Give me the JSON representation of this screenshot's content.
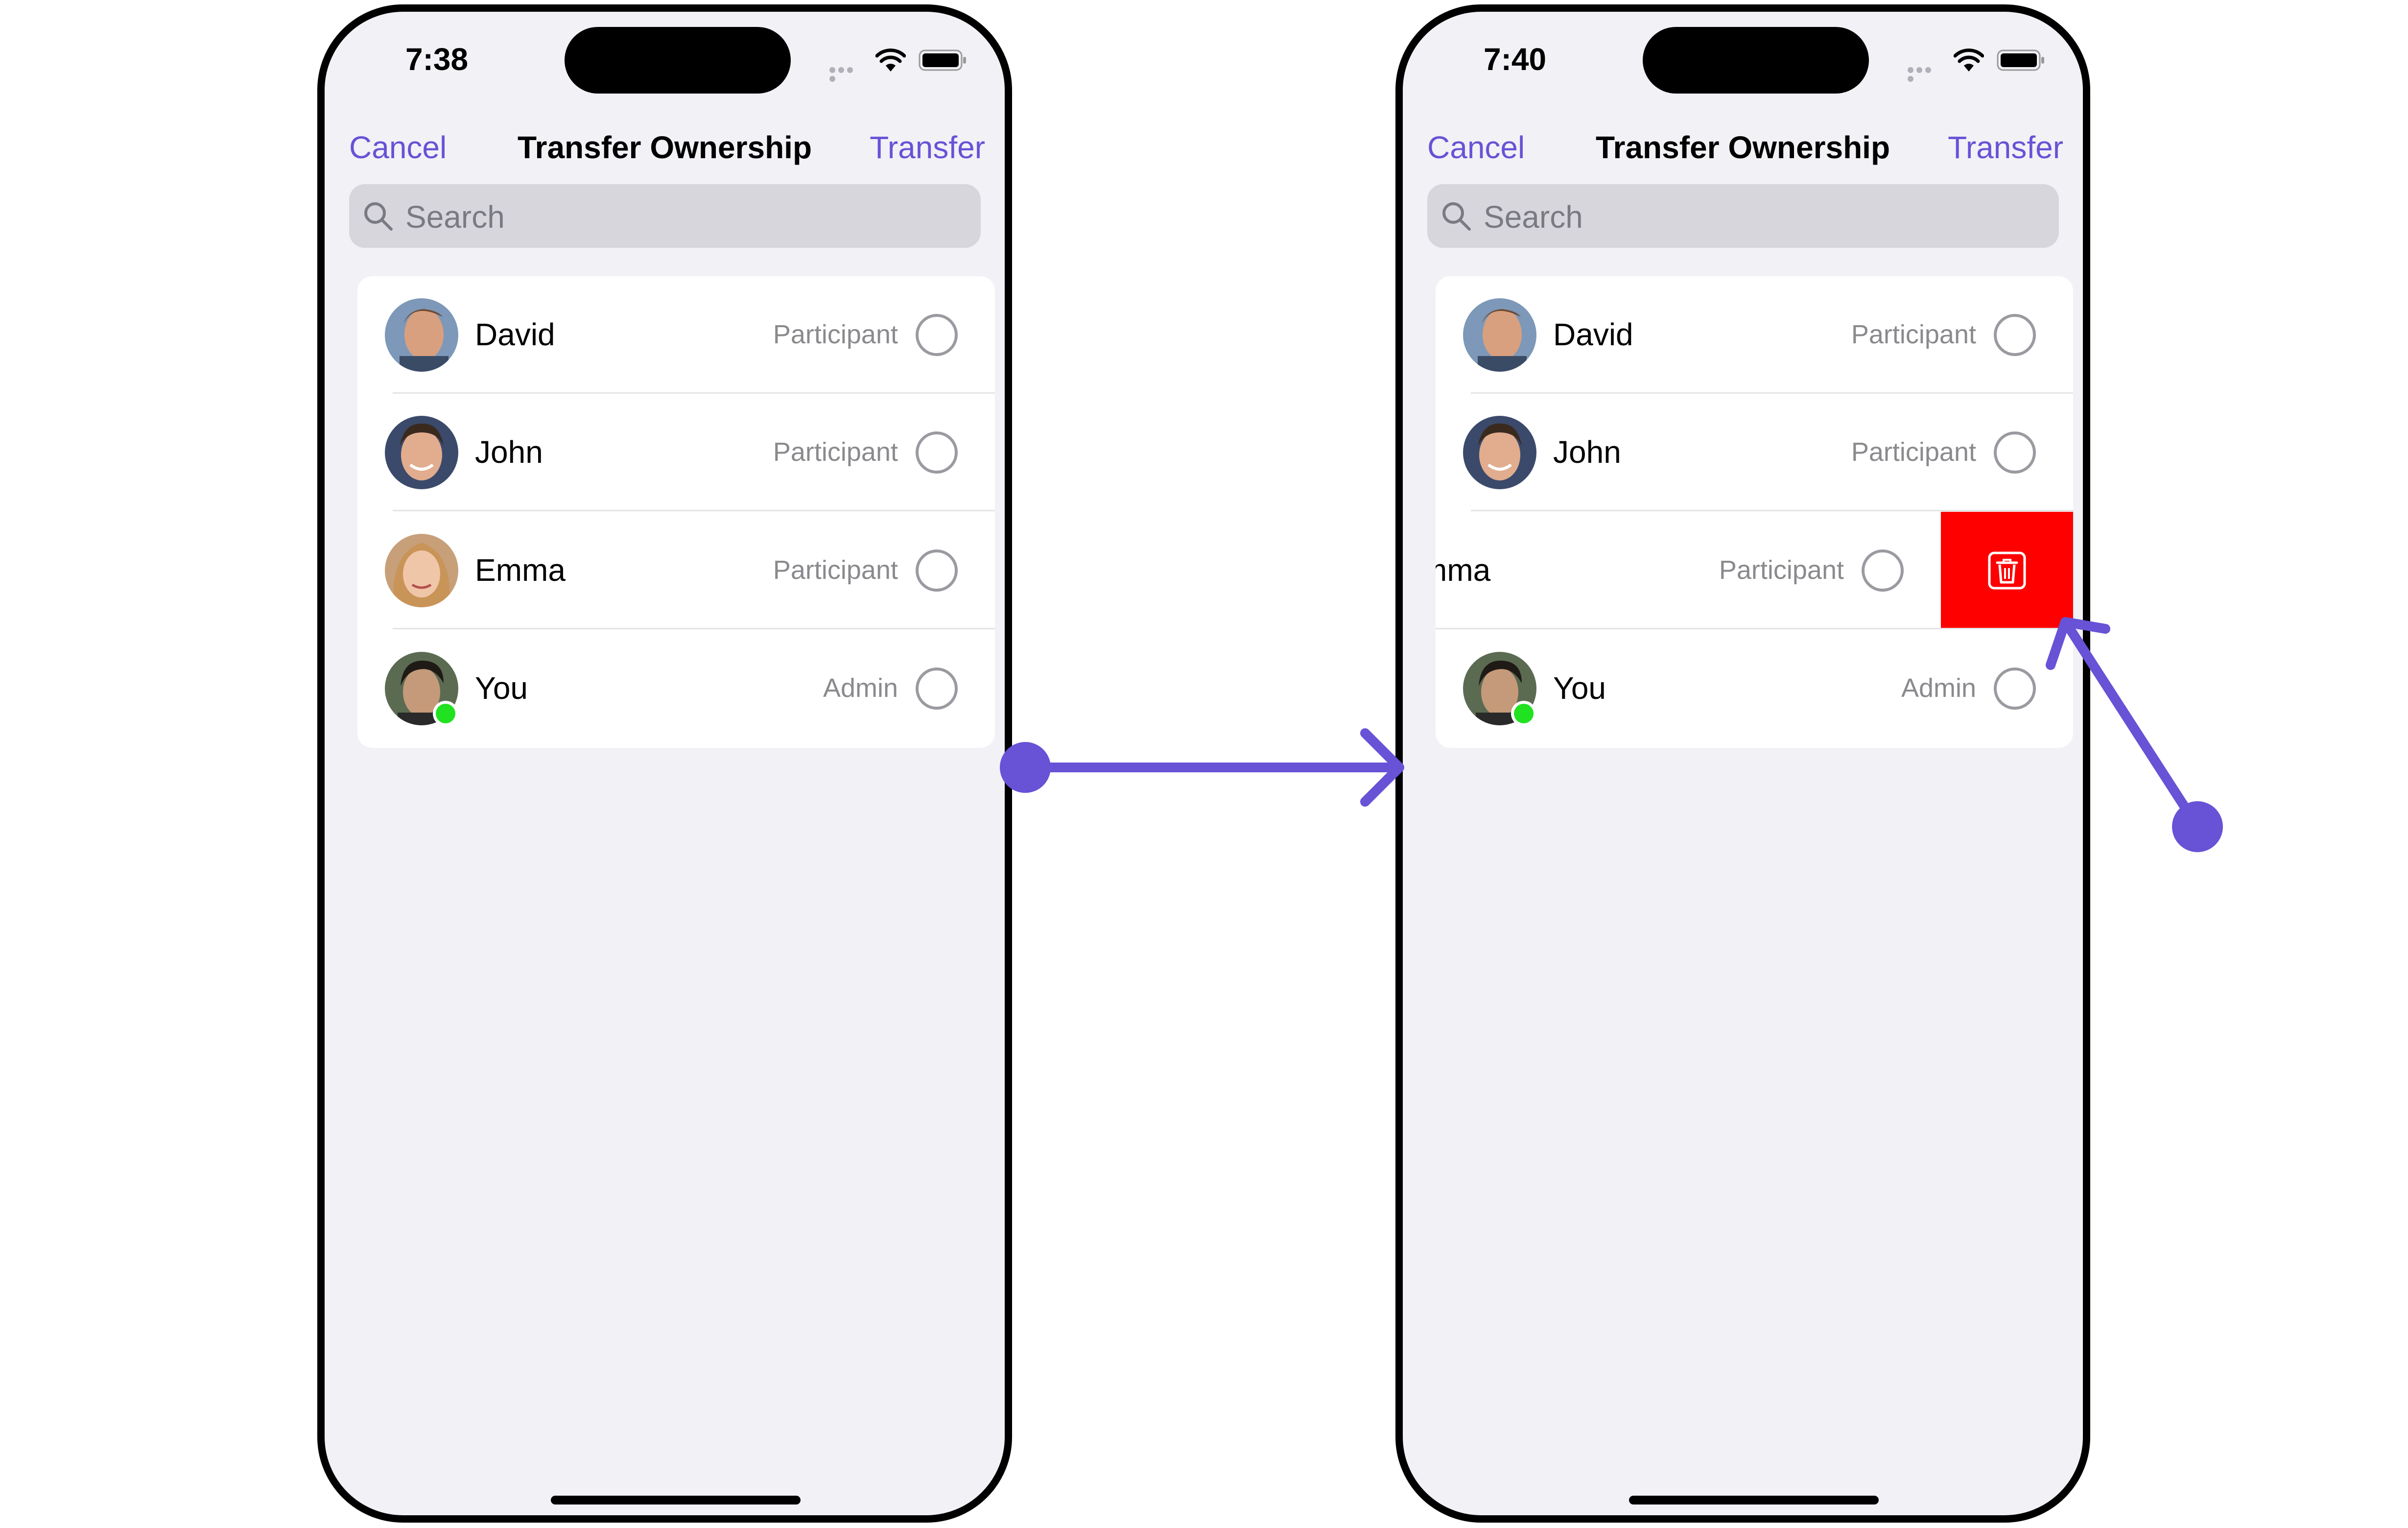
{
  "colors": {
    "accent": "#6852d6",
    "delete": "#ff0000",
    "online": "#21e221",
    "background": "#f1f1f6"
  },
  "screens": [
    {
      "time": "7:38",
      "nav": {
        "cancel": "Cancel",
        "title": "Transfer Ownership",
        "transfer": "Transfer"
      },
      "search_placeholder": "Search",
      "members": [
        {
          "name": "David",
          "role": "Participant",
          "selected": false
        },
        {
          "name": "John",
          "role": "Participant",
          "selected": false
        },
        {
          "name": "Emma",
          "role": "Participant",
          "selected": false
        },
        {
          "name": "You",
          "role": "Admin",
          "selected": false,
          "online": true
        }
      ]
    },
    {
      "time": "7:40",
      "nav": {
        "cancel": "Cancel",
        "title": "Transfer Ownership",
        "transfer": "Transfer"
      },
      "search_placeholder": "Search",
      "members": [
        {
          "name": "David",
          "role": "Participant",
          "selected": false
        },
        {
          "name": "John",
          "role": "Participant",
          "selected": false
        },
        {
          "name": "Emma",
          "role": "Participant",
          "selected": false,
          "swiped": true,
          "visible_name": "mma"
        },
        {
          "name": "You",
          "role": "Admin",
          "selected": false,
          "online": true
        }
      ],
      "swipe_action": {
        "icon": "trash-icon"
      }
    }
  ],
  "annotations": {
    "arrow_icon": "flow-arrow-icon",
    "pointer_icon": "pointer-arrow-icon"
  }
}
